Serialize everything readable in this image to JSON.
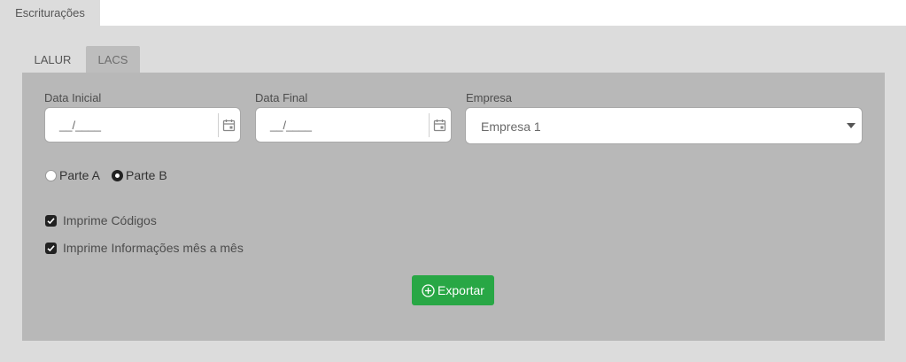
{
  "top_tab": {
    "label": "Escriturações"
  },
  "tabs": [
    {
      "label": "LALUR",
      "active": false
    },
    {
      "label": "LACS",
      "active": true
    }
  ],
  "form": {
    "data_inicial": {
      "label": "Data Inicial",
      "value": "__/____",
      "icon": "calendar-icon"
    },
    "data_final": {
      "label": "Data Final",
      "value": "__/____",
      "icon": "calendar-icon"
    },
    "empresa": {
      "label": "Empresa",
      "value": "Empresa 1"
    },
    "parte": {
      "options": [
        {
          "label": "Parte A",
          "selected": false
        },
        {
          "label": "Parte B",
          "selected": true
        }
      ]
    },
    "checkboxes": [
      {
        "label": "Imprime Códigos",
        "checked": true
      },
      {
        "label": "Imprime Informações mês a mês",
        "checked": true
      }
    ],
    "export_button": {
      "label": "Exportar",
      "icon": "plus-circle-icon",
      "color": "#28a745"
    }
  }
}
